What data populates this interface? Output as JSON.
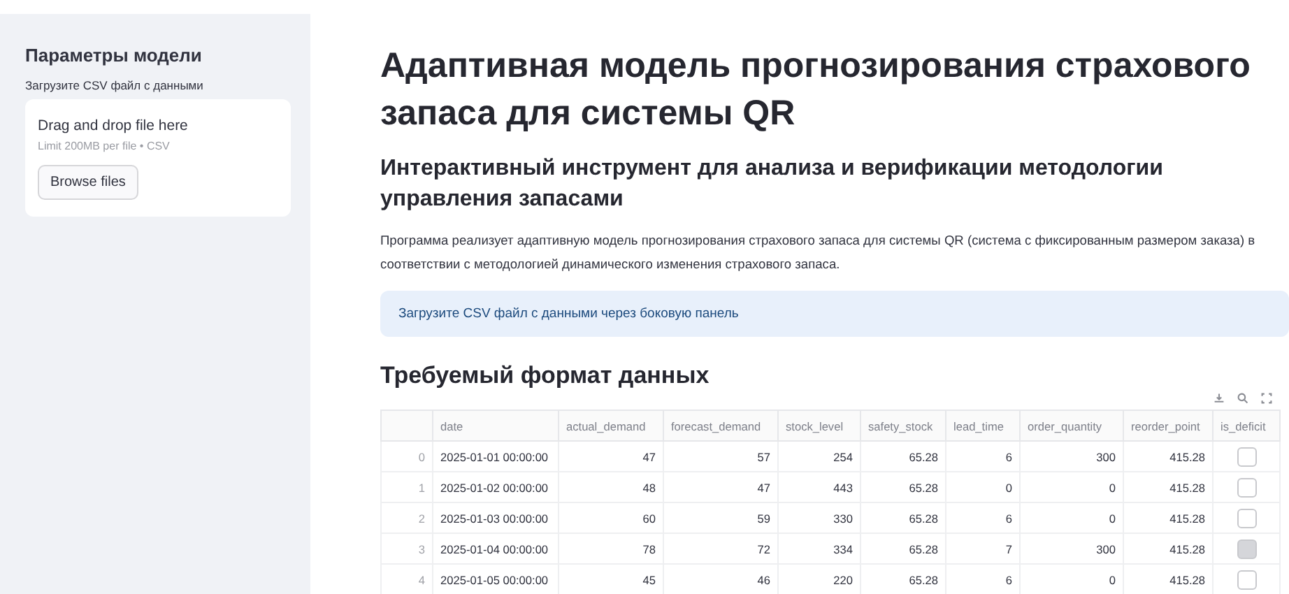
{
  "sidebar": {
    "title": "Параметры модели",
    "upload_label": "Загрузите CSV файл с данными",
    "dropzone": {
      "title": "Drag and drop file here",
      "hint": "Limit 200MB per file • CSV",
      "button": "Browse files"
    }
  },
  "main": {
    "title": "Адаптивная модель прогнозирования страхового запаса для системы QR",
    "subtitle": "Интерактивный инструмент для анализа и верификации методологии управления запасами",
    "description": "Программа реализует адаптивную модель прогнозирования страхового запаса для системы QR (система с фиксированным размером заказа) в соответствии с методологией динамического изменения страхового запаса.",
    "info": "Загрузите CSV файл с данными через боковую панель",
    "section_title": "Требуемый формат данных"
  },
  "table": {
    "columns": [
      "date",
      "actual_demand",
      "forecast_demand",
      "stock_level",
      "safety_stock",
      "lead_time",
      "order_quantity",
      "reorder_point",
      "is_deficit"
    ],
    "rows": [
      {
        "index": "0",
        "cells": [
          "2025-01-01 00:00:00",
          "47",
          "57",
          "254",
          "65.28",
          "6",
          "300",
          "415.28"
        ],
        "is_deficit": false
      },
      {
        "index": "1",
        "cells": [
          "2025-01-02 00:00:00",
          "48",
          "47",
          "443",
          "65.28",
          "0",
          "0",
          "415.28"
        ],
        "is_deficit": false
      },
      {
        "index": "2",
        "cells": [
          "2025-01-03 00:00:00",
          "60",
          "59",
          "330",
          "65.28",
          "6",
          "0",
          "415.28"
        ],
        "is_deficit": false
      },
      {
        "index": "3",
        "cells": [
          "2025-01-04 00:00:00",
          "78",
          "72",
          "334",
          "65.28",
          "7",
          "300",
          "415.28"
        ],
        "is_deficit": true
      },
      {
        "index": "4",
        "cells": [
          "2025-01-05 00:00:00",
          "45",
          "46",
          "220",
          "65.28",
          "6",
          "0",
          "415.28"
        ],
        "is_deficit": false
      }
    ]
  }
}
